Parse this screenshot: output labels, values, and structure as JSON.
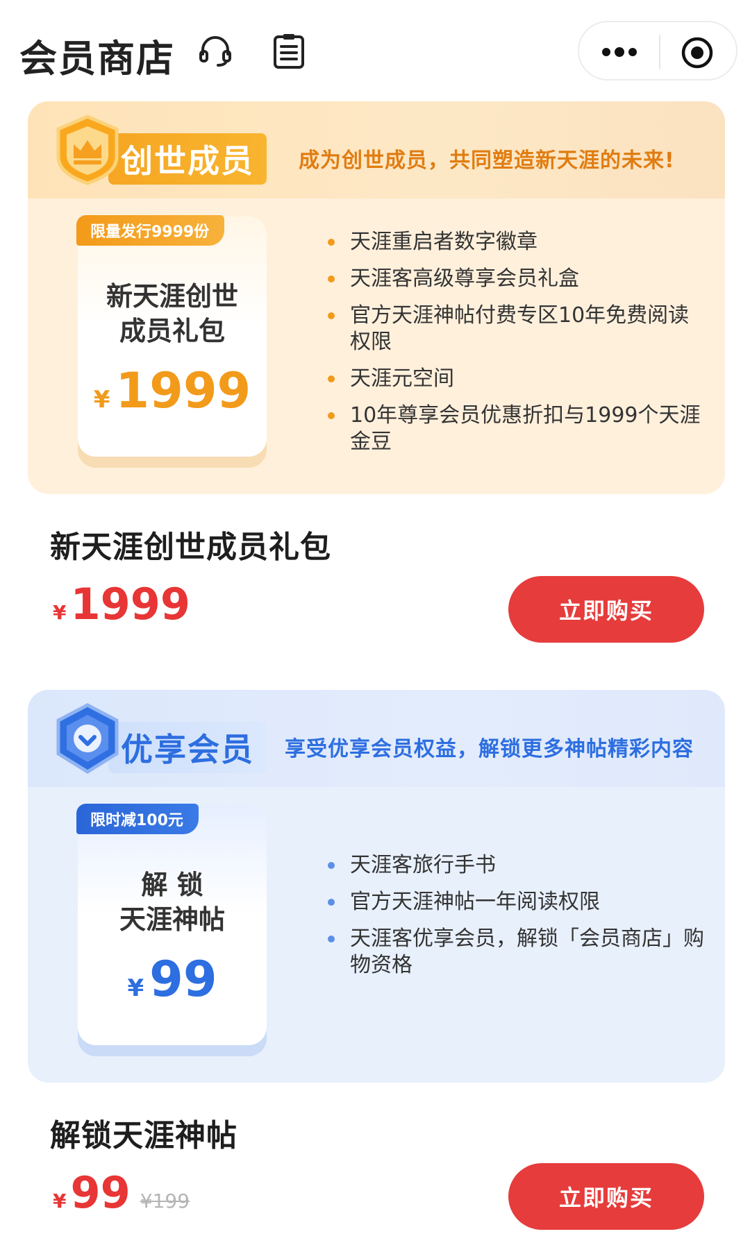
{
  "header": {
    "title": "会员商店",
    "icons": [
      "headset-icon",
      "document-list-icon",
      "more-dots-icon",
      "close-target-icon"
    ]
  },
  "founder": {
    "badge": "创世成员",
    "slogan": "成为创世成员，共同塑造新天涯的未来!",
    "tag": "限量发行9999份",
    "ticket_name_line1": "新天涯创世",
    "ticket_name_line2": "成员礼包",
    "currency": "¥",
    "ticket_price": "1999",
    "benefits": [
      "天涯重启者数字徽章",
      "天涯客高级尊享会员礼盒",
      "官方天涯神帖付费专区10年免费阅读权限",
      "天涯元空间",
      "10年尊享会员优惠折扣与1999个天涯金豆"
    ],
    "product_title": "新天涯创世成员礼包",
    "price": "1999",
    "buy_label": "立即购买",
    "colors": {
      "accent": "#f29a1a",
      "bg": "#fff0dc"
    }
  },
  "vip": {
    "badge": "优享会员",
    "slogan": "享受优享会员权益，解锁更多神帖精彩内容",
    "tag": "限时减100元",
    "ticket_name_line1": "解 锁",
    "ticket_name_line2": "天涯神帖",
    "currency": "¥",
    "ticket_price": "99",
    "benefits": [
      "天涯客旅行手书",
      "官方天涯神帖一年阅读权限",
      "天涯客优享会员，解锁「会员商店」购物资格"
    ],
    "product_title": "解锁天涯神帖",
    "price": "99",
    "original_price": "¥199",
    "buy_label": "立即购买",
    "colors": {
      "accent": "#2d6ee0",
      "bg": "#e8f0fc"
    }
  }
}
